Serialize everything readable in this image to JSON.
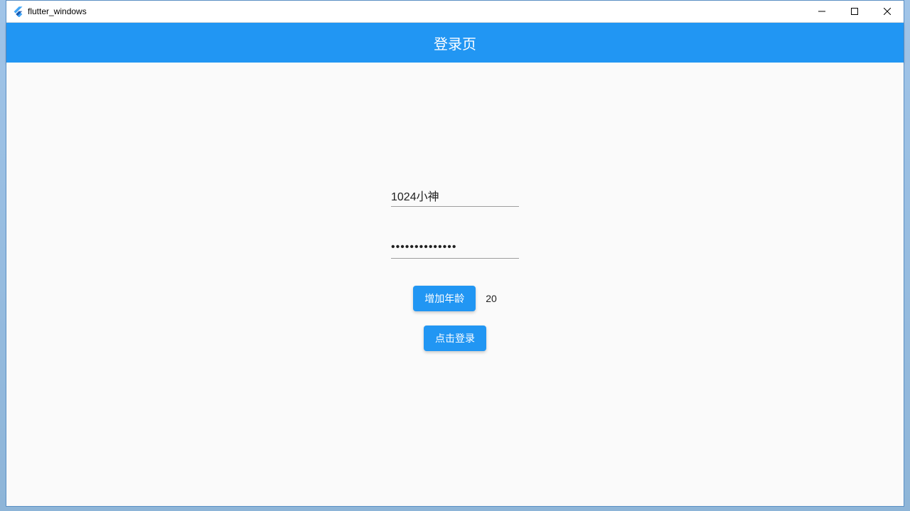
{
  "window": {
    "title": "flutter_windows"
  },
  "header": {
    "title": "登录页"
  },
  "form": {
    "username_value": "1024小神",
    "password_value": "••••••••••••••",
    "increase_age_label": "增加年龄",
    "age_value": "20",
    "login_label": "点击登录"
  }
}
